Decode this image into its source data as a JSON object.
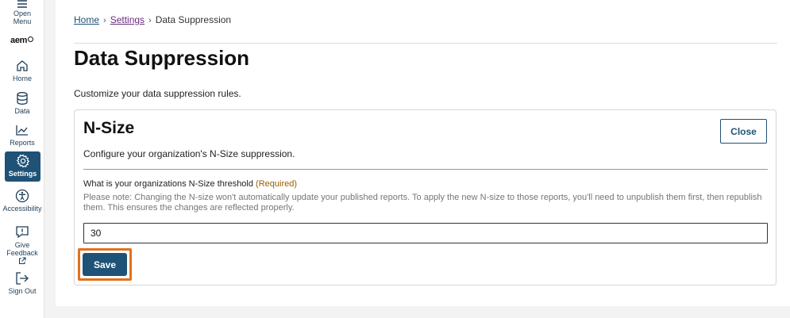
{
  "sidebar": {
    "menu_label": "Open Menu",
    "logo_text": "aem",
    "items": [
      {
        "label": "Home",
        "icon": "home-icon"
      },
      {
        "label": "Data",
        "icon": "database-icon"
      },
      {
        "label": "Reports",
        "icon": "chart-icon"
      },
      {
        "label": "Settings",
        "icon": "gear-icon",
        "active": true
      },
      {
        "label": "Accessibility",
        "icon": "accessibility-icon"
      },
      {
        "label": "Give Feedback",
        "icon": "feedback-icon"
      },
      {
        "label": "Sign Out",
        "icon": "sign-out-icon"
      }
    ],
    "accent_color": "#1e5276"
  },
  "breadcrumb": {
    "home": "Home",
    "settings": "Settings",
    "current": "Data Suppression"
  },
  "page": {
    "title": "Data Suppression",
    "description": "Customize your data suppression rules."
  },
  "card": {
    "title": "N-Size",
    "close_label": "Close",
    "description": "Configure your organization's N-Size suppression.",
    "field_label": "What is your organizations N-Size threshold",
    "field_required": "(Required)",
    "field_note": "Please note: Changing the N-size won't automatically update your published reports. To apply the new N-size to those reports, you'll need to unpublish them first, then republish them. This ensures the changes are reflected properly.",
    "field_value": "30",
    "save_label": "Save",
    "highlight_color": "#e2711d"
  }
}
